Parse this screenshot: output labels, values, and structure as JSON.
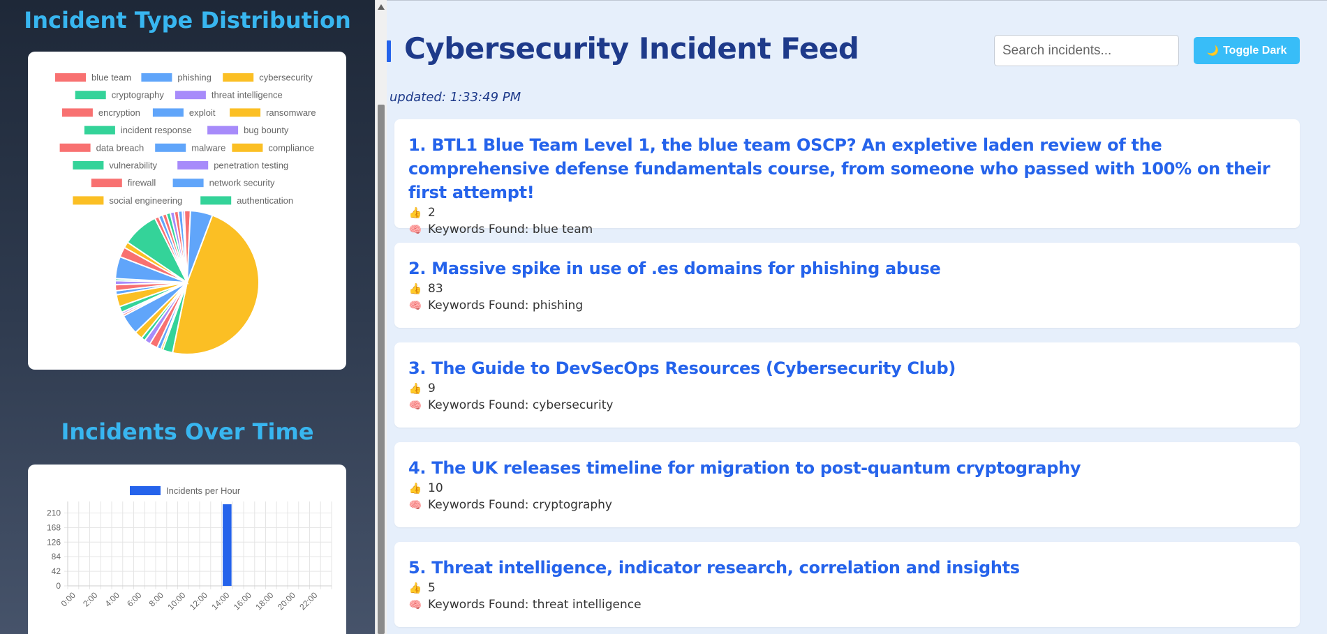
{
  "sidebar": {
    "type_heading": "Incident Type Distribution",
    "time_heading": "Incidents Over Time"
  },
  "chart_data": [
    {
      "type": "pie",
      "title": "",
      "legend_position": "top",
      "categories": [
        "blue team",
        "phishing",
        "cybersecurity",
        "cryptography",
        "threat intelligence",
        "encryption",
        "exploit",
        "ransomware",
        "incident response",
        "bug bounty",
        "data breach",
        "malware",
        "compliance",
        "vulnerability",
        "penetration testing",
        "firewall",
        "network security",
        "social engineering",
        "authentication"
      ],
      "colors": [
        "#f87171",
        "#60a5fa",
        "#fbbf24",
        "#34d399",
        "#a78bfa",
        "#f87171",
        "#60a5fa",
        "#fbbf24",
        "#34d399",
        "#a78bfa",
        "#f87171",
        "#60a5fa",
        "#fbbf24",
        "#34d399",
        "#a78bfa",
        "#f87171",
        "#60a5fa",
        "#fbbf24",
        "#34d399"
      ],
      "slices": [
        {
          "label": "cybersecurity",
          "value": 105,
          "color": "#fbbf24"
        },
        {
          "label": "authentication",
          "value": 5,
          "color": "#34d399"
        },
        {
          "label": "social engineering",
          "value": 1,
          "color": "#fbbf24"
        },
        {
          "label": "network security",
          "value": 2,
          "color": "#60a5fa"
        },
        {
          "label": "firewall",
          "value": 4,
          "color": "#f87171"
        },
        {
          "label": "penetration testing",
          "value": 3,
          "color": "#a78bfa"
        },
        {
          "label": "vulnerability",
          "value": 2,
          "color": "#34d399"
        },
        {
          "label": "compliance",
          "value": 4,
          "color": "#fbbf24"
        },
        {
          "label": "malware",
          "value": 10,
          "color": "#60a5fa"
        },
        {
          "label": "data breach",
          "value": 1,
          "color": "#f87171"
        },
        {
          "label": "bug bounty",
          "value": 1,
          "color": "#a78bfa"
        },
        {
          "label": "incident response",
          "value": 3,
          "color": "#34d399"
        },
        {
          "label": "ransomware",
          "value": 6,
          "color": "#fbbf24"
        },
        {
          "label": "exploit",
          "value": 2,
          "color": "#60a5fa"
        },
        {
          "label": "encryption",
          "value": 3,
          "color": "#f87171"
        },
        {
          "label": "threat intelligence",
          "value": 2,
          "color": "#a78bfa"
        },
        {
          "label": "cryptography",
          "value": 1,
          "color": "#34d399"
        },
        {
          "label": "phishing",
          "value": 11,
          "color": "#60a5fa"
        },
        {
          "label": "blue team",
          "value": 5,
          "color": "#f87171"
        },
        {
          "label": "cybersecurity",
          "value": 3,
          "color": "#fbbf24"
        },
        {
          "label": "cryptography",
          "value": 18,
          "color": "#34d399"
        },
        {
          "label": "encryption",
          "value": 2,
          "color": "#f87171"
        },
        {
          "label": "exploit",
          "value": 2,
          "color": "#60a5fa"
        },
        {
          "label": "blue team",
          "value": 2,
          "color": "#f87171"
        },
        {
          "label": "incident response",
          "value": 2,
          "color": "#34d399"
        },
        {
          "label": "bug bounty",
          "value": 2,
          "color": "#a78bfa"
        },
        {
          "label": "data breach",
          "value": 2,
          "color": "#f87171"
        },
        {
          "label": "malware",
          "value": 2,
          "color": "#60a5fa"
        },
        {
          "label": "threat intelligence",
          "value": 1,
          "color": "#a78bfa"
        },
        {
          "label": "blue team",
          "value": 3,
          "color": "#f87171"
        },
        {
          "label": "phishing",
          "value": 11,
          "color": "#60a5fa"
        }
      ]
    },
    {
      "type": "bar",
      "title": "",
      "series": [
        {
          "name": "Incidents per Hour",
          "color": "#2563eb",
          "values": [
            0,
            0,
            0,
            0,
            0,
            0,
            0,
            0,
            0,
            0,
            0,
            0,
            0,
            0,
            235,
            0,
            0,
            0,
            0,
            0,
            0,
            0,
            0,
            0,
            0
          ]
        }
      ],
      "categories": [
        "0:00",
        "1:00",
        "2:00",
        "3:00",
        "4:00",
        "5:00",
        "6:00",
        "7:00",
        "8:00",
        "9:00",
        "10:00",
        "11:00",
        "12:00",
        "13:00",
        "14:00",
        "15:00",
        "16:00",
        "17:00",
        "18:00",
        "19:00",
        "20:00",
        "21:00",
        "22:00",
        "23:00"
      ],
      "x_tick_labels": [
        "0:00",
        "2:00",
        "4:00",
        "6:00",
        "8:00",
        "10:00",
        "12:00",
        "14:00",
        "16:00",
        "18:00",
        "20:00",
        "22:00"
      ],
      "y_ticks": [
        0,
        42,
        84,
        126,
        168,
        210
      ],
      "ylim": [
        0,
        235
      ],
      "grid": true,
      "legend_position": "top"
    }
  ],
  "main": {
    "title": "Cybersecurity Incident Feed",
    "search_placeholder": "Search incidents...",
    "toggle_icon": "🌙",
    "toggle_label": "Toggle Dark",
    "updated_text": "updated: 1:33:49 PM",
    "keywords_prefix": "Keywords Found: ",
    "thumb_glyph": "👍",
    "brain_glyph": "🧠",
    "incidents": [
      {
        "title": "1. BTL1 Blue Team Level 1, the blue team OSCP? An expletive laden review of the comprehensive defense fundamentals course, from someone who passed with 100% on their first attempt!",
        "votes": "2",
        "keywords": "Keywords Found: blue team"
      },
      {
        "title": "2. Massive spike in use of .es domains for phishing abuse",
        "votes": "83",
        "keywords": "Keywords Found: phishing"
      },
      {
        "title": "3. The Guide to DevSecOps Resources (Cybersecurity Club)",
        "votes": "9",
        "keywords": "Keywords Found: cybersecurity"
      },
      {
        "title": "4. The UK releases timeline for migration to post-quantum cryptography",
        "votes": "10",
        "keywords": "Keywords Found: cryptography"
      },
      {
        "title": "5. Threat intelligence, indicator research, correlation and insights",
        "votes": "5",
        "keywords": "Keywords Found: threat intelligence"
      }
    ]
  }
}
